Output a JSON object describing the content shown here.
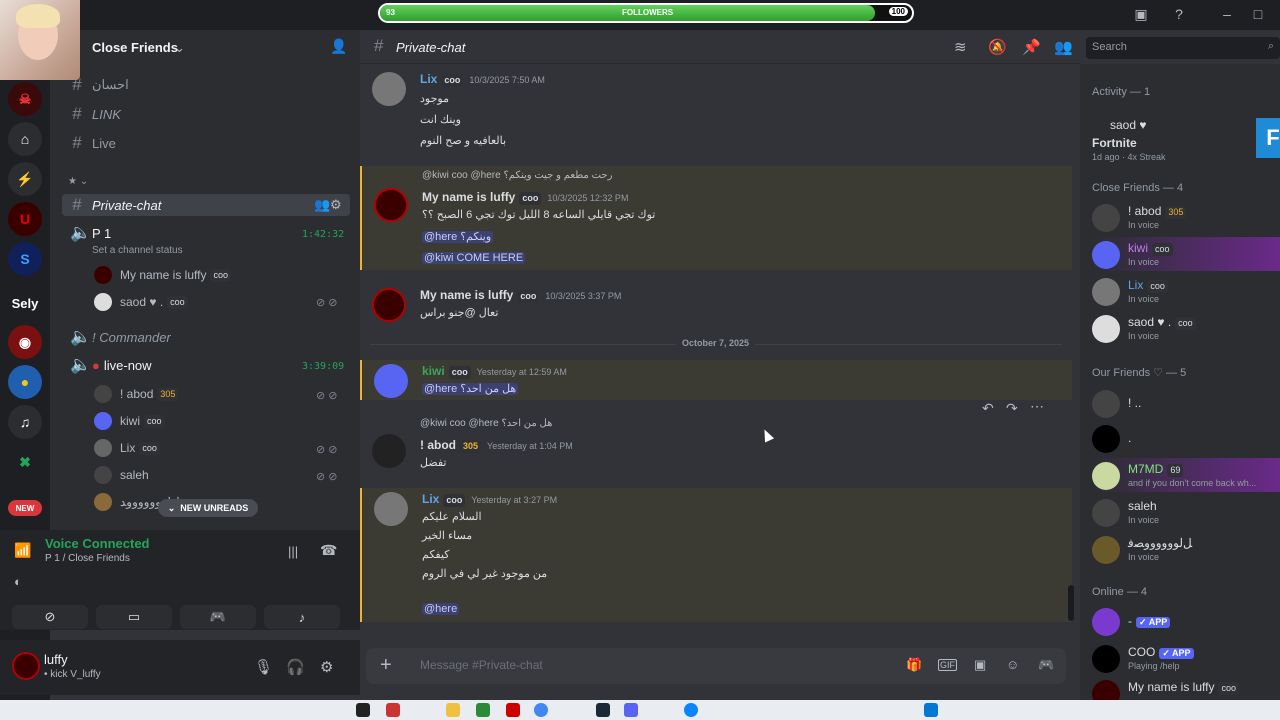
{
  "followers": {
    "label": "FOLLOWERS",
    "current": "93",
    "max": "100",
    "progress": 0.93
  },
  "guild": {
    "name": "Close Friends"
  },
  "channels": [
    {
      "name": "احسان",
      "italic": false
    },
    {
      "name": "LINK",
      "italic": true
    },
    {
      "name": "Live",
      "italic": false
    },
    {
      "name": "Private-chat",
      "italic": true,
      "active": true
    }
  ],
  "voice_channels": [
    {
      "name": "P 1",
      "time": "1:42:32",
      "status": "Set a channel status",
      "members": [
        {
          "name": "My name is luffy",
          "tag": "coo"
        },
        {
          "name": "saod ♥ .",
          "tag": "coo"
        }
      ]
    },
    {
      "name": "! Commander"
    },
    {
      "name": "live-now",
      "time": "3:39:09",
      "members": [
        {
          "name": "! abod",
          "tag": "305"
        },
        {
          "name": "kiwi",
          "tag": "coo"
        },
        {
          "name": "Lix",
          "tag": "coo"
        },
        {
          "name": "saleh",
          "tag": ""
        },
        {
          "name": "ﻞﻟﻮﻭﻭﻭﻭﻭﻭﺪ",
          "tag": ""
        }
      ]
    }
  ],
  "unreads_label": "NEW UNREADS",
  "voice": {
    "title": "Voice Connected",
    "subtitle": "P 1 / Close Friends"
  },
  "user": {
    "name": "luffy",
    "status": "• kick V_luffy"
  },
  "chat": {
    "channel": "Private-chat",
    "search_placeholder": "Search",
    "composer_placeholder": "Message #Private-chat",
    "date_divider": "October 7, 2025",
    "messages": [
      {
        "author": "Lix",
        "tag": "coo",
        "time": "10/3/2025 7:50 AM",
        "lines": [
          "موجود",
          "وينك انت",
          "بالعافيه و صح النوم"
        ]
      },
      {
        "reply": "@kiwi  coo  @here رحت مطعم و جيت وينكم؟",
        "author": "My name is luffy",
        "tag": "coo",
        "time": "10/3/2025 12:32 PM",
        "lines": [
          "توك تجي قايلي الساعه 8 الليل توك تجي 6 الصبح ؟؟",
          "@here وينكم؟",
          "@kiwi COME HERE"
        ]
      },
      {
        "author": "My name is luffy",
        "tag": "coo",
        "time": "10/3/2025 3:37 PM",
        "lines": [
          "تعال @جنو براس"
        ]
      },
      {
        "author": "kiwi",
        "tag": "coo",
        "time": "Yesterday at 12:59 AM",
        "lines": [
          "@here هل من احد؟"
        ]
      },
      {
        "reply": "@kiwi  coo  @here هل من احد؟",
        "author": "! abod",
        "tag": "305",
        "time": "Yesterday at 1:04 PM",
        "lines": [
          "تفضل"
        ]
      },
      {
        "author": "Lix",
        "tag": "coo",
        "time": "Yesterday at 3:27 PM",
        "lines": [
          "السلام عليكم",
          "مساء الخير",
          "كيفكم",
          "من موجود غير لي في الروم",
          "",
          "@here"
        ]
      }
    ]
  },
  "members": {
    "activity_header": "Activity — 1",
    "activity": {
      "name": "saod ♥",
      "game": "Fortnite",
      "meta": "1d ago · 4x Streak",
      "tile": "F"
    },
    "close_header": "Close Friends — 4",
    "close": [
      {
        "name": "! abod",
        "tag": "305",
        "status": "In voice"
      },
      {
        "name": "kiwi",
        "tag": "coo",
        "status": "In voice"
      },
      {
        "name": "Lix",
        "tag": "coo",
        "status": "In voice"
      },
      {
        "name": "saod ♥ .",
        "tag": "coo",
        "status": "In voice"
      }
    ],
    "friends_header": "Our Friends ♡ — 5",
    "friends": [
      {
        "name": "! ..",
        "status": ""
      },
      {
        "name": ".",
        "status": ""
      },
      {
        "name": "M7MD",
        "tag": "69",
        "status": "and if you don't come back wh..."
      },
      {
        "name": "saleh",
        "status": "In voice"
      },
      {
        "name": "ﻞﻟﻮﻭﻭﻭﻭﻭﺼﻓ",
        "status": "In voice"
      }
    ],
    "online_header": "Online — 4",
    "online": [
      {
        "name": "-",
        "badge": "✓ APP",
        "status": ""
      },
      {
        "name": "COO",
        "badge": "✓ APP",
        "status": "Playing /help"
      },
      {
        "name": "My name is luffy",
        "tag": "coo",
        "status": ""
      }
    ]
  },
  "new_badge": "NEW",
  "server_label": "Sely",
  "colors": {
    "accent": "#5865f2",
    "online": "#23a55a",
    "highlight": "#f0b232"
  }
}
